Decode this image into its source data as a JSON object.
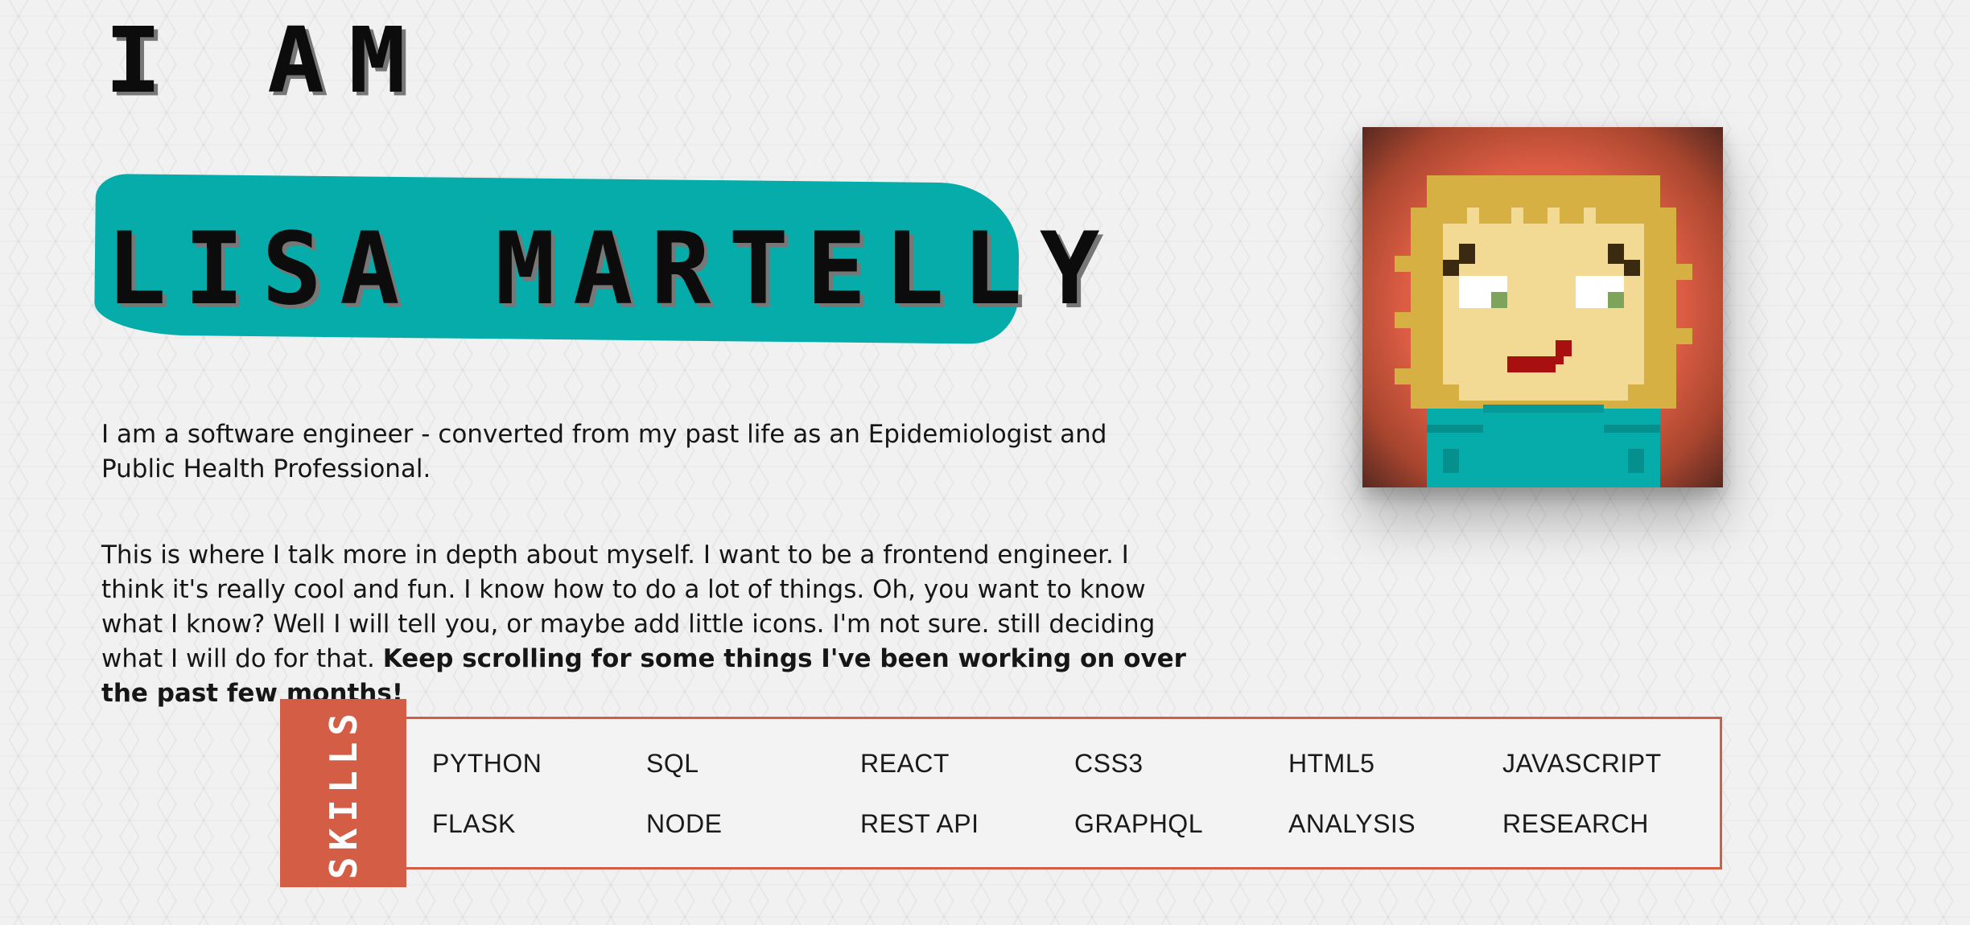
{
  "hero": {
    "intro": "I AM",
    "name": "LISA MARTELLY"
  },
  "about": {
    "paragraph1": "I am a software engineer - converted from my past life as an Epidemiologist and Public Health Professional.",
    "paragraph2_text": "This is where I talk more in depth about myself. I want to be a frontend engineer. I think it's really cool and fun. I know how to do a lot of things. Oh, you want to know what I know? Well I will tell you, or maybe add little icons. I'm not sure. still deciding what I will do for that. ",
    "paragraph2_bold": "Keep scrolling for some things I've been working on over the past few months!"
  },
  "avatar": {
    "icon": "pixel-avatar-icon"
  },
  "skills": {
    "label": "SKILLS",
    "row1": [
      "PYTHON",
      "SQL",
      "REACT",
      "CSS3",
      "HTML5",
      "JAVASCRIPT"
    ],
    "row2": [
      "FLASK",
      "NODE",
      "REST API",
      "GRAPHQL",
      "ANALYSIS",
      "RESEARCH"
    ]
  },
  "colors": {
    "accent_teal": "#05aca9",
    "accent_orange": "#d45d45",
    "text": "#111111",
    "background": "#f1f1f1"
  }
}
